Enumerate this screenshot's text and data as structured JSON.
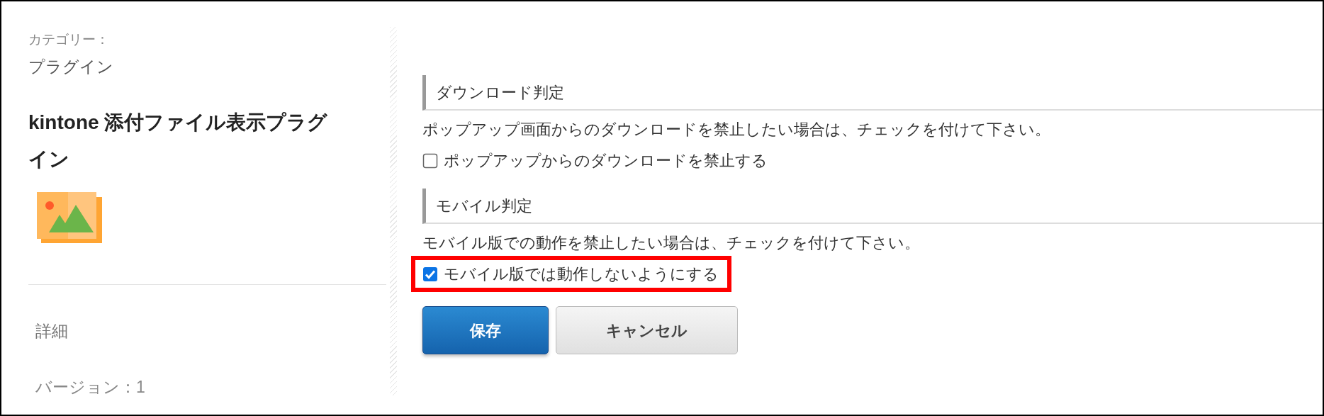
{
  "sidebar": {
    "category_label": "カテゴリー：",
    "category": "プラグイン",
    "title": "kintone 添付ファイル表示プラグイン",
    "details_link": "詳細",
    "version": "バージョン：1"
  },
  "sections": [
    {
      "heading": "ダウンロード判定",
      "description": "ポップアップ画面からのダウンロードを禁止したい場合は、チェックを付けて下さい。",
      "option": {
        "label": "ポップアップからのダウンロードを禁止する",
        "checked": false,
        "highlighted": false
      }
    },
    {
      "heading": "モバイル判定",
      "description": "モバイル版での動作を禁止したい場合は、チェックを付けて下さい。",
      "option": {
        "label": "モバイル版では動作しないようにする",
        "checked": true,
        "highlighted": true
      }
    }
  ],
  "buttons": [
    {
      "label": "保存",
      "kind": "primary"
    },
    {
      "label": "キャンセル",
      "kind": "secondary"
    }
  ]
}
